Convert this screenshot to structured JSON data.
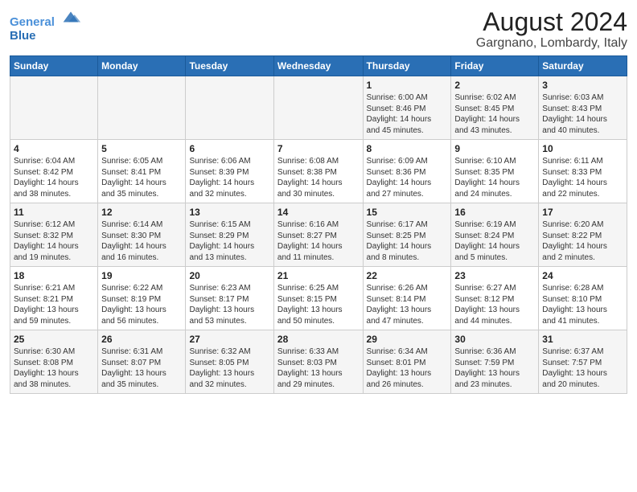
{
  "header": {
    "logo_line1": "General",
    "logo_line2": "Blue",
    "title": "August 2024",
    "subtitle": "Gargnano, Lombardy, Italy"
  },
  "days_of_week": [
    "Sunday",
    "Monday",
    "Tuesday",
    "Wednesday",
    "Thursday",
    "Friday",
    "Saturday"
  ],
  "weeks": [
    [
      {
        "day": "",
        "info": ""
      },
      {
        "day": "",
        "info": ""
      },
      {
        "day": "",
        "info": ""
      },
      {
        "day": "",
        "info": ""
      },
      {
        "day": "1",
        "info": "Sunrise: 6:00 AM\nSunset: 8:46 PM\nDaylight: 14 hours\nand 45 minutes."
      },
      {
        "day": "2",
        "info": "Sunrise: 6:02 AM\nSunset: 8:45 PM\nDaylight: 14 hours\nand 43 minutes."
      },
      {
        "day": "3",
        "info": "Sunrise: 6:03 AM\nSunset: 8:43 PM\nDaylight: 14 hours\nand 40 minutes."
      }
    ],
    [
      {
        "day": "4",
        "info": "Sunrise: 6:04 AM\nSunset: 8:42 PM\nDaylight: 14 hours\nand 38 minutes."
      },
      {
        "day": "5",
        "info": "Sunrise: 6:05 AM\nSunset: 8:41 PM\nDaylight: 14 hours\nand 35 minutes."
      },
      {
        "day": "6",
        "info": "Sunrise: 6:06 AM\nSunset: 8:39 PM\nDaylight: 14 hours\nand 32 minutes."
      },
      {
        "day": "7",
        "info": "Sunrise: 6:08 AM\nSunset: 8:38 PM\nDaylight: 14 hours\nand 30 minutes."
      },
      {
        "day": "8",
        "info": "Sunrise: 6:09 AM\nSunset: 8:36 PM\nDaylight: 14 hours\nand 27 minutes."
      },
      {
        "day": "9",
        "info": "Sunrise: 6:10 AM\nSunset: 8:35 PM\nDaylight: 14 hours\nand 24 minutes."
      },
      {
        "day": "10",
        "info": "Sunrise: 6:11 AM\nSunset: 8:33 PM\nDaylight: 14 hours\nand 22 minutes."
      }
    ],
    [
      {
        "day": "11",
        "info": "Sunrise: 6:12 AM\nSunset: 8:32 PM\nDaylight: 14 hours\nand 19 minutes."
      },
      {
        "day": "12",
        "info": "Sunrise: 6:14 AM\nSunset: 8:30 PM\nDaylight: 14 hours\nand 16 minutes."
      },
      {
        "day": "13",
        "info": "Sunrise: 6:15 AM\nSunset: 8:29 PM\nDaylight: 14 hours\nand 13 minutes."
      },
      {
        "day": "14",
        "info": "Sunrise: 6:16 AM\nSunset: 8:27 PM\nDaylight: 14 hours\nand 11 minutes."
      },
      {
        "day": "15",
        "info": "Sunrise: 6:17 AM\nSunset: 8:25 PM\nDaylight: 14 hours\nand 8 minutes."
      },
      {
        "day": "16",
        "info": "Sunrise: 6:19 AM\nSunset: 8:24 PM\nDaylight: 14 hours\nand 5 minutes."
      },
      {
        "day": "17",
        "info": "Sunrise: 6:20 AM\nSunset: 8:22 PM\nDaylight: 14 hours\nand 2 minutes."
      }
    ],
    [
      {
        "day": "18",
        "info": "Sunrise: 6:21 AM\nSunset: 8:21 PM\nDaylight: 13 hours\nand 59 minutes."
      },
      {
        "day": "19",
        "info": "Sunrise: 6:22 AM\nSunset: 8:19 PM\nDaylight: 13 hours\nand 56 minutes."
      },
      {
        "day": "20",
        "info": "Sunrise: 6:23 AM\nSunset: 8:17 PM\nDaylight: 13 hours\nand 53 minutes."
      },
      {
        "day": "21",
        "info": "Sunrise: 6:25 AM\nSunset: 8:15 PM\nDaylight: 13 hours\nand 50 minutes."
      },
      {
        "day": "22",
        "info": "Sunrise: 6:26 AM\nSunset: 8:14 PM\nDaylight: 13 hours\nand 47 minutes."
      },
      {
        "day": "23",
        "info": "Sunrise: 6:27 AM\nSunset: 8:12 PM\nDaylight: 13 hours\nand 44 minutes."
      },
      {
        "day": "24",
        "info": "Sunrise: 6:28 AM\nSunset: 8:10 PM\nDaylight: 13 hours\nand 41 minutes."
      }
    ],
    [
      {
        "day": "25",
        "info": "Sunrise: 6:30 AM\nSunset: 8:08 PM\nDaylight: 13 hours\nand 38 minutes."
      },
      {
        "day": "26",
        "info": "Sunrise: 6:31 AM\nSunset: 8:07 PM\nDaylight: 13 hours\nand 35 minutes."
      },
      {
        "day": "27",
        "info": "Sunrise: 6:32 AM\nSunset: 8:05 PM\nDaylight: 13 hours\nand 32 minutes."
      },
      {
        "day": "28",
        "info": "Sunrise: 6:33 AM\nSunset: 8:03 PM\nDaylight: 13 hours\nand 29 minutes."
      },
      {
        "day": "29",
        "info": "Sunrise: 6:34 AM\nSunset: 8:01 PM\nDaylight: 13 hours\nand 26 minutes."
      },
      {
        "day": "30",
        "info": "Sunrise: 6:36 AM\nSunset: 7:59 PM\nDaylight: 13 hours\nand 23 minutes."
      },
      {
        "day": "31",
        "info": "Sunrise: 6:37 AM\nSunset: 7:57 PM\nDaylight: 13 hours\nand 20 minutes."
      }
    ]
  ]
}
